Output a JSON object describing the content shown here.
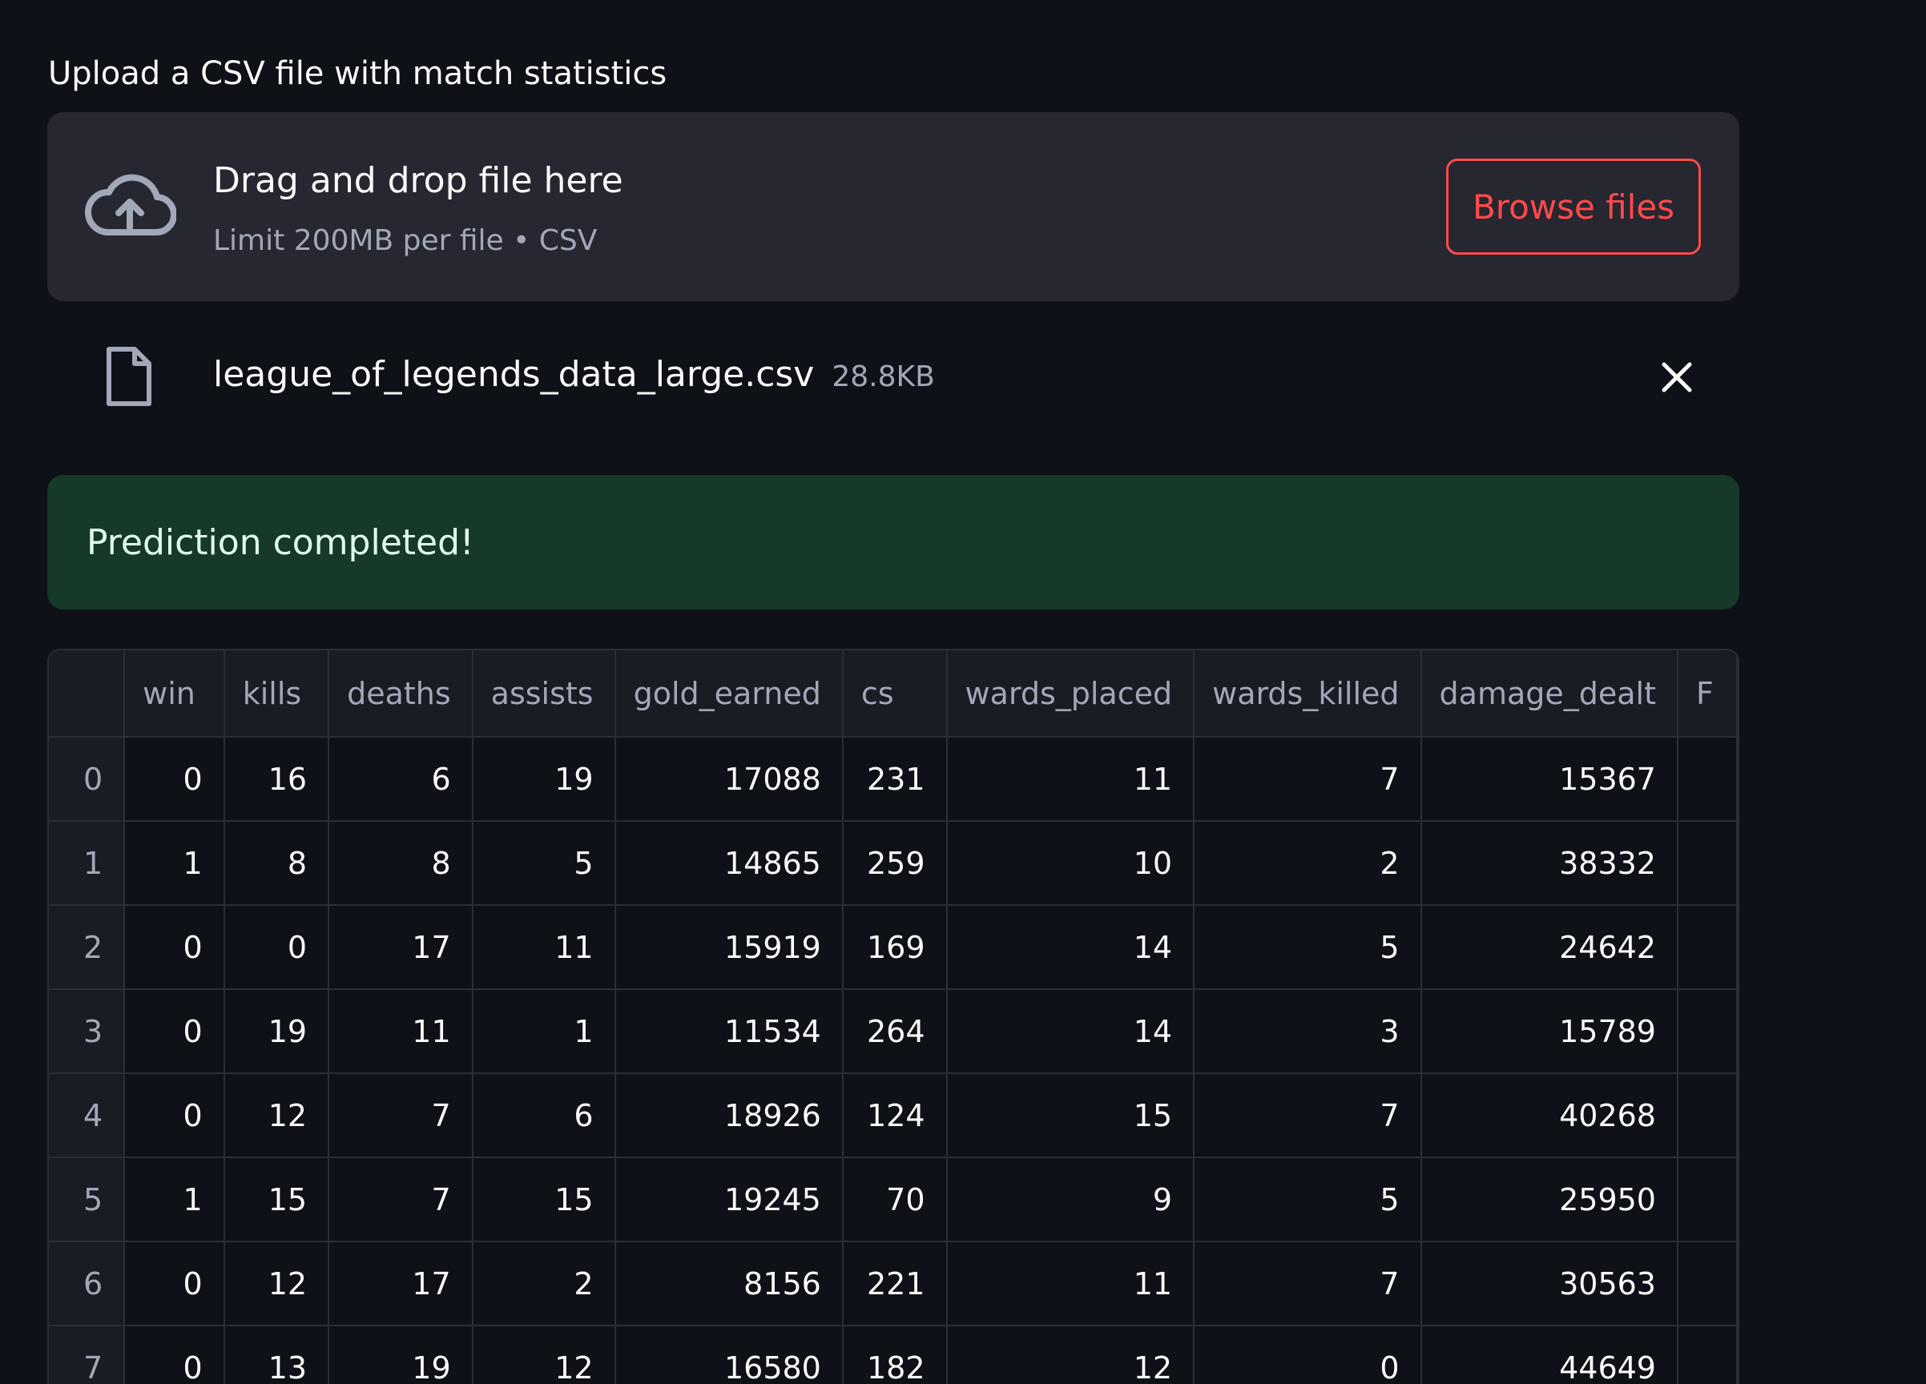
{
  "uploader": {
    "label": "Upload a CSV file with match statistics",
    "dropzone_title": "Drag and drop file here",
    "dropzone_subtitle": "Limit 200MB per file • CSV",
    "browse_label": "Browse files",
    "icon": "cloud-upload-icon"
  },
  "file": {
    "name": "league_of_legends_data_large.csv",
    "size": "28.8KB",
    "icon": "file-icon",
    "remove_icon": "close-icon"
  },
  "alert": {
    "message": "Prediction completed!"
  },
  "colors": {
    "background": "#0e1117",
    "dropzone": "#262730",
    "accent": "#ff4b4b",
    "success_bg": "#173928",
    "success_text": "#dffde9"
  },
  "table": {
    "columns": [
      "",
      "win",
      "kills",
      "deaths",
      "assists",
      "gold_earned",
      "cs",
      "wards_placed",
      "wards_killed",
      "damage_dealt",
      "F"
    ],
    "rows": [
      [
        "0",
        "0",
        "16",
        "6",
        "19",
        "17088",
        "231",
        "11",
        "7",
        "15367",
        ""
      ],
      [
        "1",
        "1",
        "8",
        "8",
        "5",
        "14865",
        "259",
        "10",
        "2",
        "38332",
        ""
      ],
      [
        "2",
        "0",
        "0",
        "17",
        "11",
        "15919",
        "169",
        "14",
        "5",
        "24642",
        ""
      ],
      [
        "3",
        "0",
        "19",
        "11",
        "1",
        "11534",
        "264",
        "14",
        "3",
        "15789",
        ""
      ],
      [
        "4",
        "0",
        "12",
        "7",
        "6",
        "18926",
        "124",
        "15",
        "7",
        "40268",
        ""
      ],
      [
        "5",
        "1",
        "15",
        "7",
        "15",
        "19245",
        "70",
        "9",
        "5",
        "25950",
        ""
      ],
      [
        "6",
        "0",
        "12",
        "17",
        "2",
        "8156",
        "221",
        "11",
        "7",
        "30563",
        ""
      ],
      [
        "7",
        "0",
        "13",
        "19",
        "12",
        "16580",
        "182",
        "12",
        "0",
        "44649",
        ""
      ]
    ]
  }
}
